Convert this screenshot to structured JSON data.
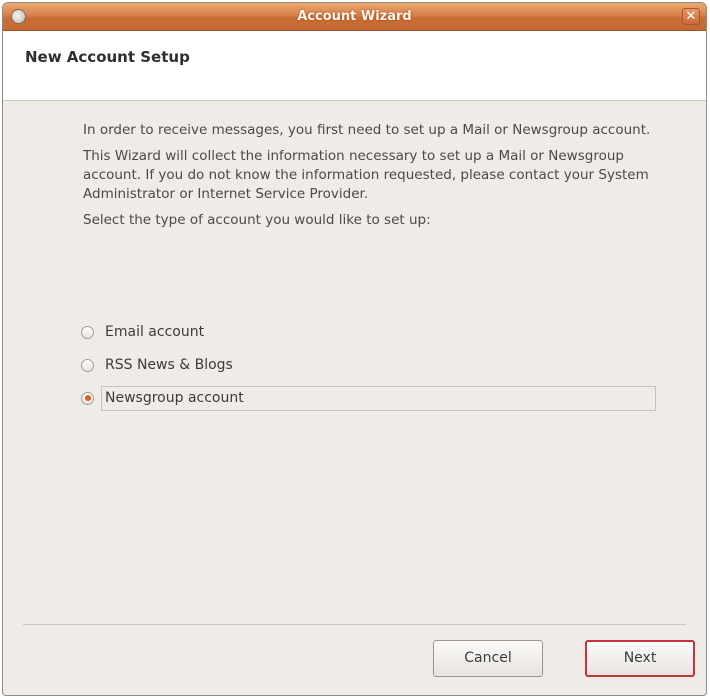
{
  "window": {
    "title": "Account Wizard",
    "close_glyph": "✕"
  },
  "header": {
    "title": "New Account Setup"
  },
  "content": {
    "paragraph1": "In order to receive messages, you first need to set up a Mail or Newsgroup account.",
    "paragraph2": "This Wizard will collect the information necessary to set up a Mail or Newsgroup account. If you do not know the information requested, please contact your System Administrator or Internet Service Provider.",
    "prompt": "Select the type of account you would like to set up:"
  },
  "account_types": [
    {
      "label": "Email account",
      "selected": false
    },
    {
      "label": "RSS News & Blogs",
      "selected": false
    },
    {
      "label": "Newsgroup account",
      "selected": true
    }
  ],
  "buttons": {
    "cancel": "Cancel",
    "next": "Next"
  },
  "colors": {
    "titlebar": "#d9814a",
    "radio_selected": "#d4602b",
    "default_button_border": "#c8323c"
  },
  "icons": {
    "window_menu": "window-menu-icon",
    "close": "close-icon"
  }
}
